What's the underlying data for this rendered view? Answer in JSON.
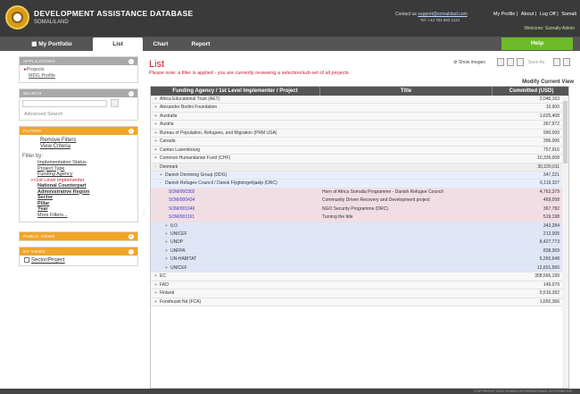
{
  "header": {
    "app_title": "DEVELOPMENT ASSISTANCE DATABASE",
    "subtitle": "SOMALILAND",
    "contact_label": "Contact us",
    "contact_email": "support@somalidad.com",
    "contact_tel": "Tel: +44 784 983 1110",
    "links": [
      "My Profile",
      "About",
      "Log Off",
      "Somali"
    ],
    "welcome": "Welcome: Somaliy Admin"
  },
  "nav": {
    "tabs": [
      "My Portfolio",
      "List",
      "Chart",
      "Report"
    ],
    "active_tab": "List",
    "help_label": "Help"
  },
  "sidebar": {
    "applications": {
      "title": "APPLICATIONS",
      "items": [
        "Projects",
        "MDG Profile"
      ]
    },
    "search": {
      "title": "SEARCH",
      "placeholder": "",
      "advanced": "Advanced Search"
    },
    "filters": {
      "title": "FILTERS",
      "remove": "Remove Filters",
      "view": "View Criteria",
      "filter_by": "Filter by:",
      "options": [
        {
          "label": "Implementation Status",
          "state": "normal"
        },
        {
          "label": "Project Type",
          "state": "normal"
        },
        {
          "label": "Funding Agency",
          "state": "normal"
        },
        {
          "label": ">>1st Level Implementer",
          "state": "active"
        },
        {
          "label": "National Counterpart",
          "state": "bold"
        },
        {
          "label": "Administrative Region",
          "state": "bold"
        },
        {
          "label": "Sector",
          "state": "bold"
        },
        {
          "label": "Pillar",
          "state": "bold"
        },
        {
          "label": "Year",
          "state": "bold"
        },
        {
          "label": "More Filters...",
          "state": "normal"
        }
      ]
    },
    "public_views": {
      "title": "PUBLIC VIEWS"
    },
    "my_views": {
      "title": "MY VIEWS",
      "items": [
        "Sector/Project"
      ]
    }
  },
  "main": {
    "title": "List",
    "notice": "Please note: a filter is applied - you are currently reviewing a selection/sub-set of all projects",
    "show_images": "Show images",
    "save_as": "Save As",
    "modify": "Modify Current View",
    "columns": [
      "Funding Agency / 1st Level Implementer / Project",
      "Title",
      "Committed (USD)"
    ],
    "rows": [
      {
        "level": 0,
        "exp": "+",
        "label": "Africa Educational Trust (AET)",
        "title": "",
        "value": "2,046,163"
      },
      {
        "level": 0,
        "exp": "+",
        "label": "Alexander Bodini Foundation",
        "title": "",
        "value": "10,900"
      },
      {
        "level": 0,
        "exp": "+",
        "label": "Australia",
        "title": "",
        "value": "1,625,408"
      },
      {
        "level": 0,
        "exp": "+",
        "label": "Austria",
        "title": "",
        "value": "367,972"
      },
      {
        "level": 0,
        "exp": "+",
        "label": "Bureau of Population, Refugees, and Migration (PRM USA)",
        "title": "",
        "value": "990,000"
      },
      {
        "level": 0,
        "exp": "+",
        "label": "Canada",
        "title": "",
        "value": "396,006"
      },
      {
        "level": 0,
        "exp": "+",
        "label": "Caritas Luxembourg",
        "title": "",
        "value": "757,916"
      },
      {
        "level": 0,
        "exp": "+",
        "label": "Common Humanitarian Fund (CHF)",
        "title": "",
        "value": "10,335,008"
      },
      {
        "level": 0,
        "exp": "-",
        "label": "Denmark",
        "title": "",
        "value": "30,220,011"
      },
      {
        "level": 1,
        "exp": "+",
        "label": "Danish Demining Group (DDG)",
        "title": "",
        "value": "347,221"
      },
      {
        "level": 1,
        "exp": "-",
        "label": "Danish Refugee Council / Dansk Flygtningehjaelp (DRC)",
        "title": "",
        "value": "6,119,337"
      },
      {
        "level": 3,
        "exp": "",
        "label": "SOM/000302",
        "title": "Horn of Africa Somalia Programme - Danish Refugee Council",
        "value": "4,763,379"
      },
      {
        "level": 3,
        "exp": "",
        "label": "SOM/000434",
        "title": "Community Driven Recovery and Development project",
        "value": "469,058"
      },
      {
        "level": 3,
        "exp": "",
        "label": "SOM/001046",
        "title": "NGO Security Programme (DRC)",
        "value": "367,782"
      },
      {
        "level": 3,
        "exp": "",
        "label": "SOM/001161",
        "title": "Turning the tide",
        "value": "519,198"
      },
      {
        "level": 2,
        "exp": "+",
        "label": "ILO",
        "title": "",
        "value": "343,284"
      },
      {
        "level": 2,
        "exp": "+",
        "label": "UNICEF",
        "title": "",
        "value": "212,005"
      },
      {
        "level": 2,
        "exp": "+",
        "label": "UNDP",
        "title": "",
        "value": "8,427,773"
      },
      {
        "level": 2,
        "exp": "+",
        "label": "UNFPA",
        "title": "",
        "value": "838,369"
      },
      {
        "level": 2,
        "exp": "+",
        "label": "UN-HABITAT",
        "title": "",
        "value": "5,260,648"
      },
      {
        "level": 2,
        "exp": "+",
        "label": "UNICEF",
        "title": "",
        "value": "12,651,566"
      },
      {
        "level": 0,
        "exp": "+",
        "label": "EC",
        "title": "",
        "value": "358,566,199"
      },
      {
        "level": 0,
        "exp": "+",
        "label": "FAO",
        "title": "",
        "value": "149,079"
      },
      {
        "level": 0,
        "exp": "+",
        "label": "Finland",
        "title": "",
        "value": "5,516,392"
      },
      {
        "level": 0,
        "exp": "+",
        "label": "Forsthuset Nd (FCA)",
        "title": "",
        "value": "1,650,366"
      }
    ]
  },
  "footer": {
    "text": "COPYRIGHT 2010 SOMALI INTERNATIONAL SYSTEMS INC"
  },
  "colors": {
    "accent_red": "#c81a2a",
    "help_green": "#6dbb2a",
    "filter_orange": "#f0a52a",
    "header_dark": "#3a3a3a"
  }
}
